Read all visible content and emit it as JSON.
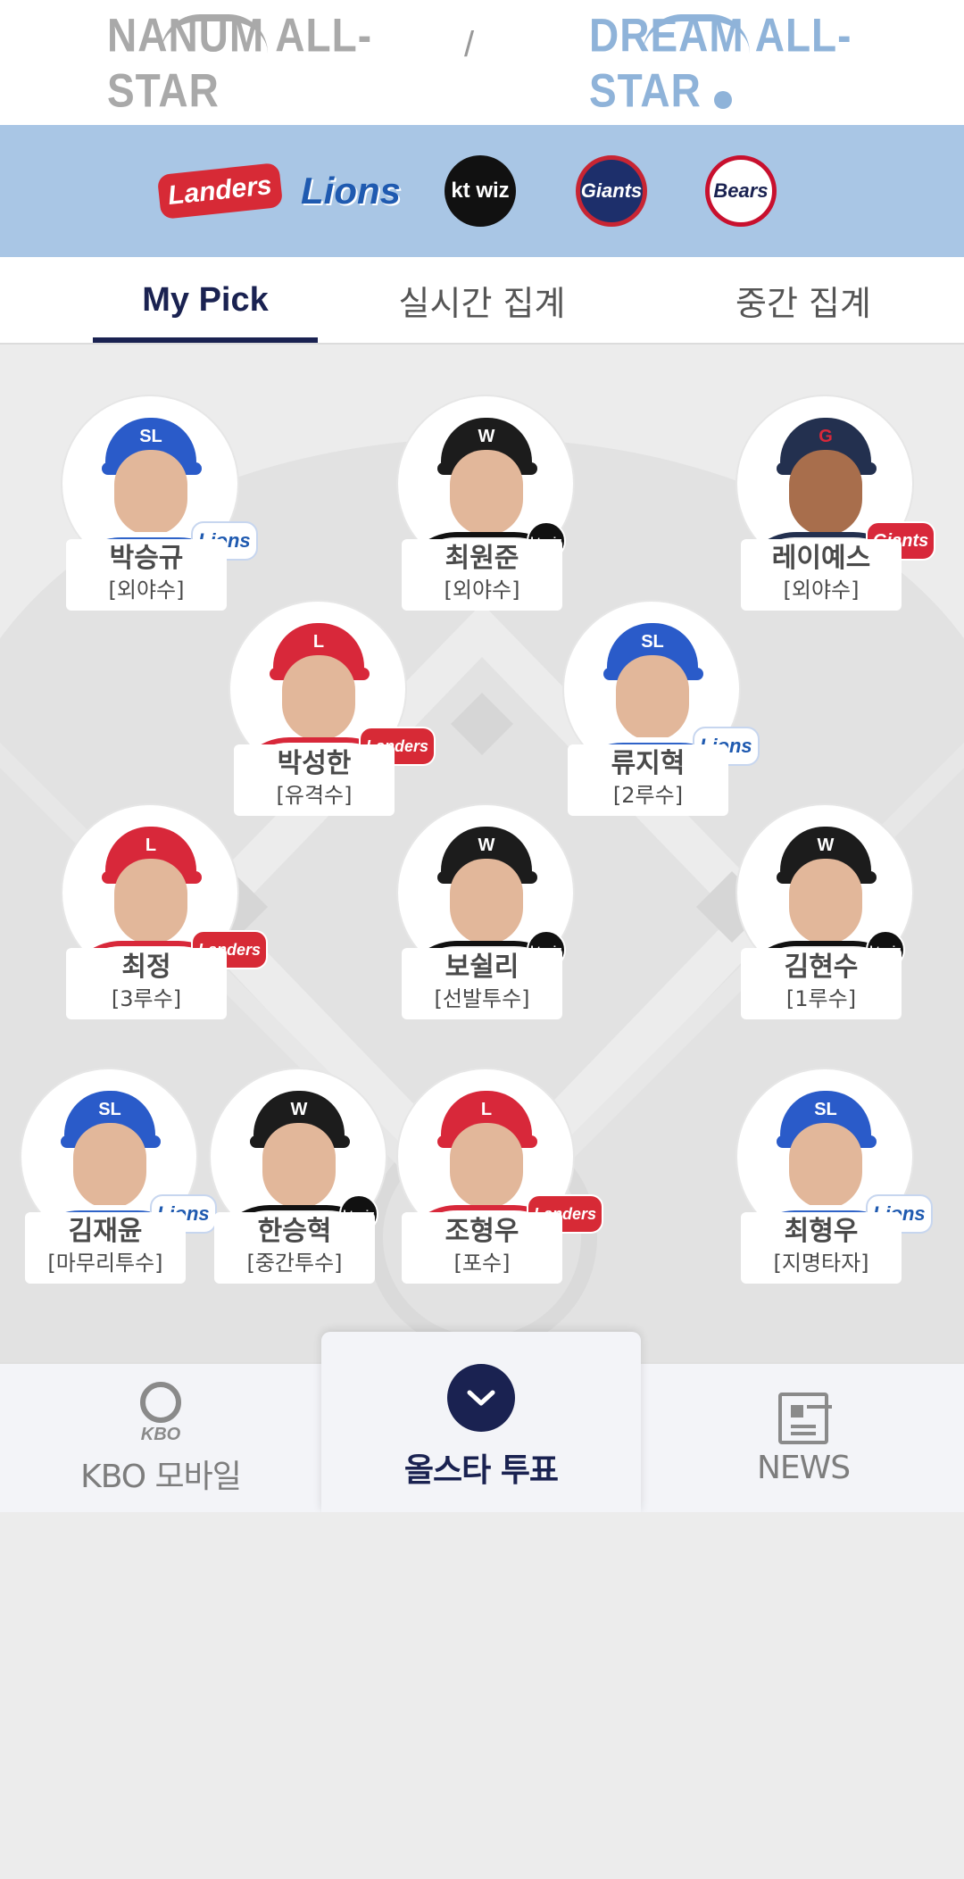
{
  "leagues": {
    "nanum_logo": "NANUM ALL-STAR",
    "separator": "/",
    "dream_logo": "DREAM ALL-STAR",
    "selected": "dream"
  },
  "teams": [
    {
      "id": "landers",
      "label": "Landers",
      "color": "#d72a36"
    },
    {
      "id": "lions",
      "label": "Lions",
      "color": "#1f5ab0"
    },
    {
      "id": "ktwiz",
      "label": "kt wiz",
      "color": "#111111"
    },
    {
      "id": "giants",
      "label": "Giants",
      "color": "#1d2f6b"
    },
    {
      "id": "bears",
      "label": "Bears",
      "color": "#1a2251"
    }
  ],
  "tabs": [
    {
      "label": "My Pick",
      "active": true
    },
    {
      "label": "실시간 집계",
      "active": false
    },
    {
      "label": "중간 집계",
      "active": false
    }
  ],
  "players": [
    {
      "name": "박승규",
      "position": "[외야수]",
      "team": "lions"
    },
    {
      "name": "최원준",
      "position": "[외야수]",
      "team": "ktwiz"
    },
    {
      "name": "레이예스",
      "position": "[외야수]",
      "team": "giants"
    },
    {
      "name": "박성한",
      "position": "[유격수]",
      "team": "landers"
    },
    {
      "name": "류지혁",
      "position": "[2루수]",
      "team": "lions"
    },
    {
      "name": "최정",
      "position": "[3루수]",
      "team": "landers"
    },
    {
      "name": "보쉴리",
      "position": "[선발투수]",
      "team": "ktwiz"
    },
    {
      "name": "김현수",
      "position": "[1루수]",
      "team": "ktwiz"
    },
    {
      "name": "김재윤",
      "position": "[마무리투수]",
      "team": "lions"
    },
    {
      "name": "한승혁",
      "position": "[중간투수]",
      "team": "ktwiz"
    },
    {
      "name": "조형우",
      "position": "[포수]",
      "team": "landers"
    },
    {
      "name": "최형우",
      "position": "[지명타자]",
      "team": "lions"
    }
  ],
  "bottom_nav": {
    "kbo_label": "KBO 모바일",
    "kbo_logo_text": "KBO",
    "vote_label": "올스타 투표",
    "news_label": "NEWS"
  },
  "colors": {
    "navy": "#1a2251",
    "band": "#a9c6e5",
    "field_bg": "#ececec"
  }
}
